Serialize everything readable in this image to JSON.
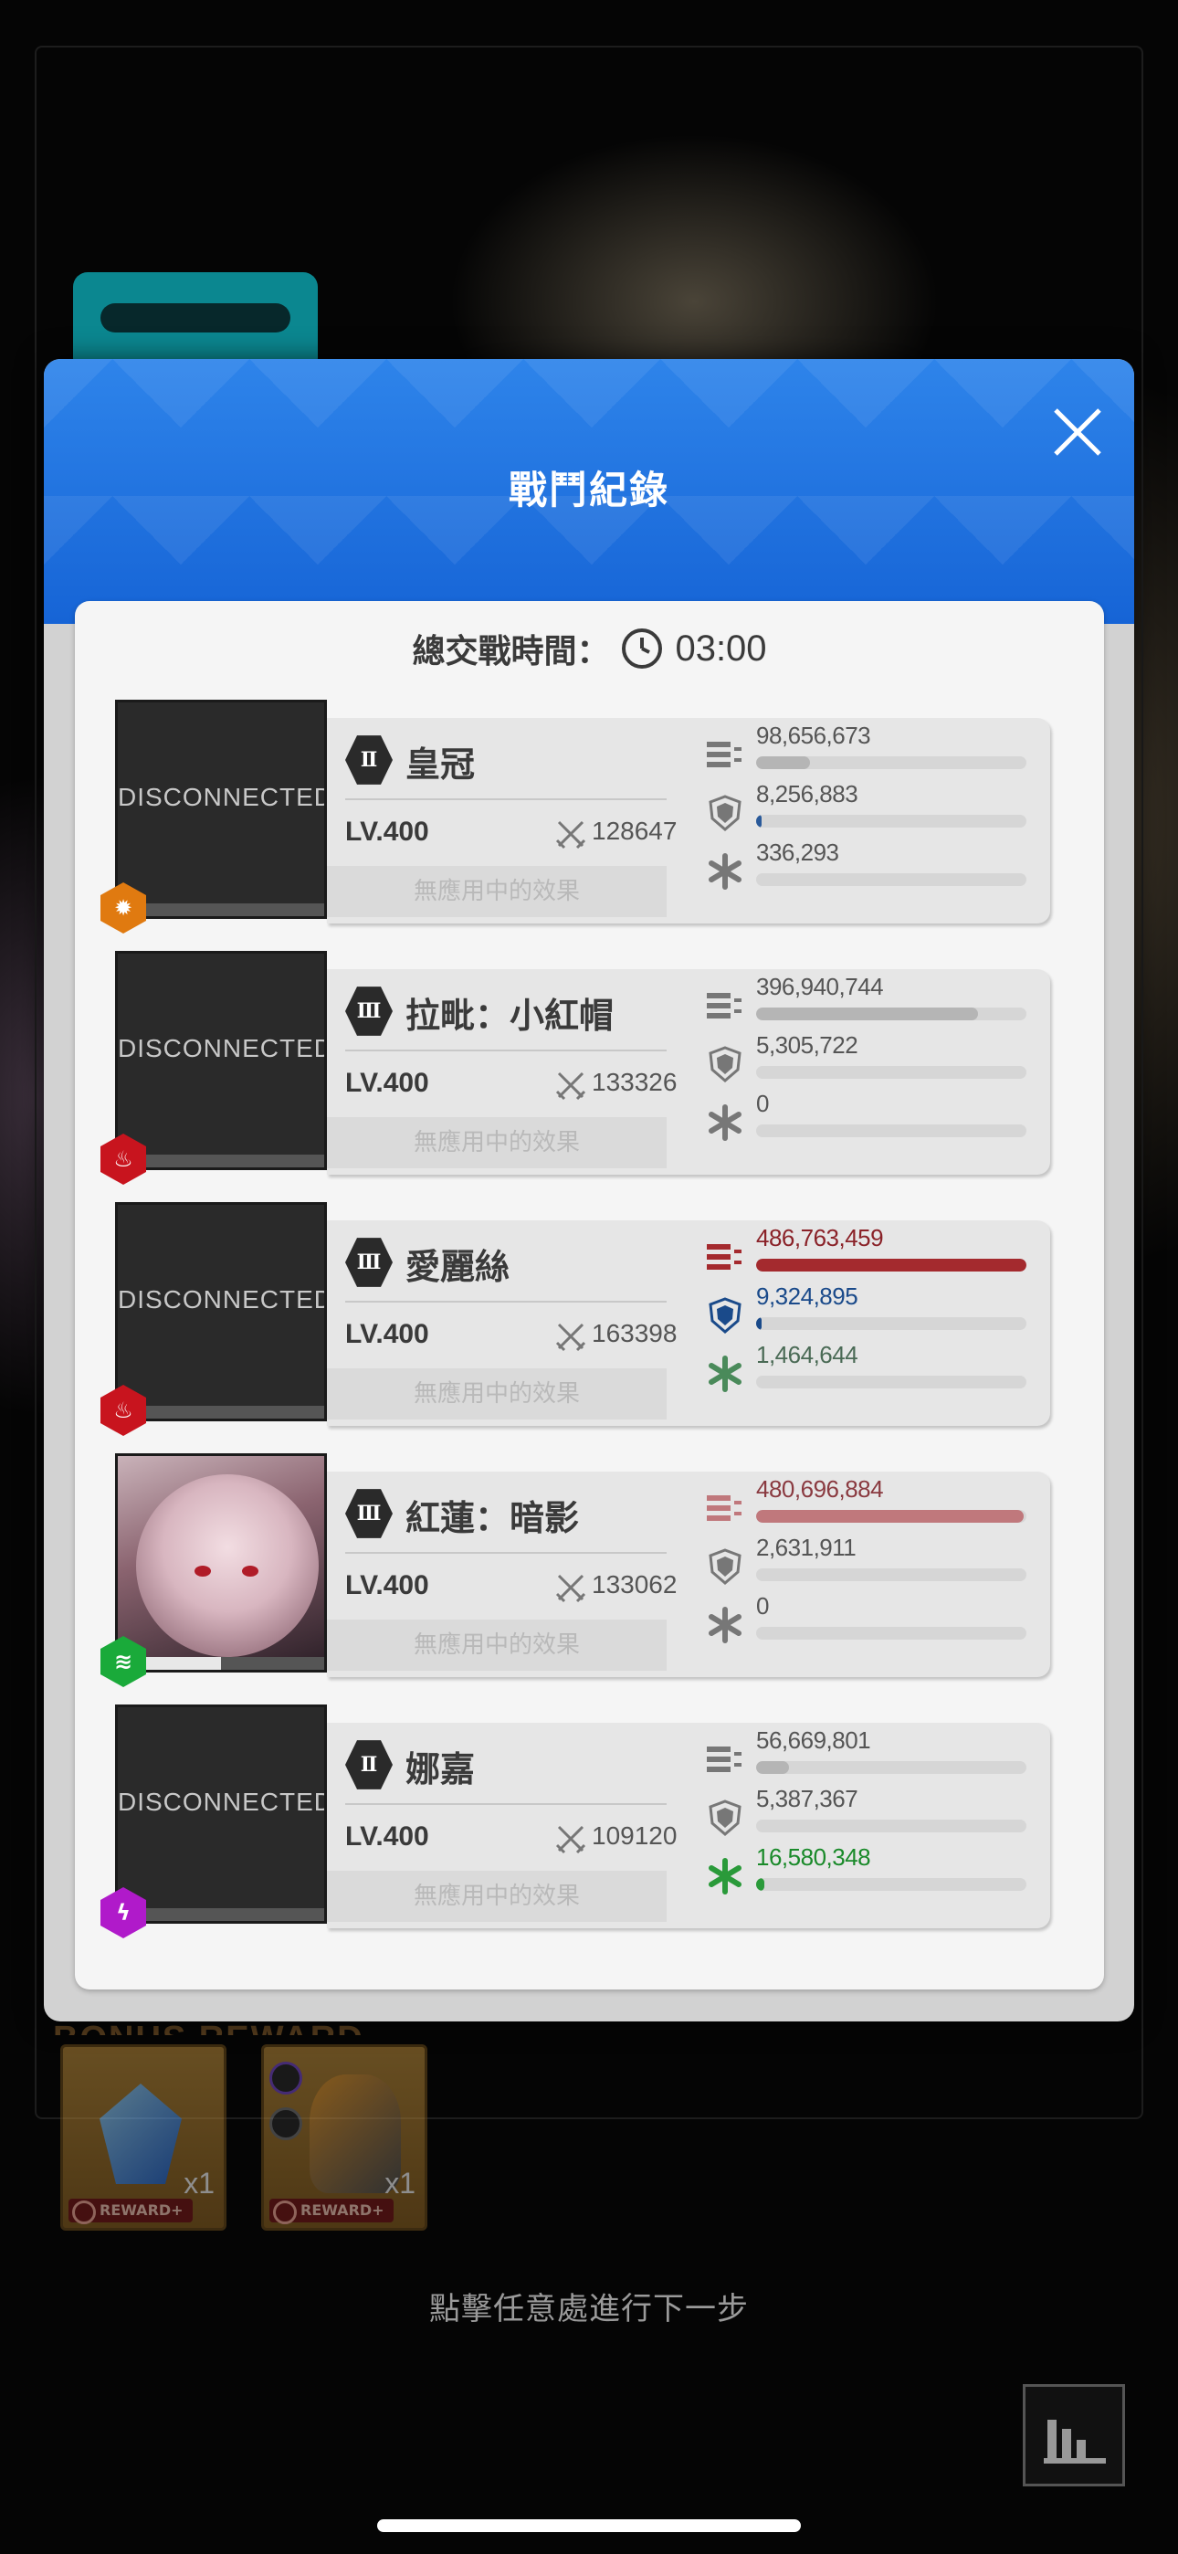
{
  "modal": {
    "title": "戰鬥紀錄",
    "time_label": "總交戰時間：",
    "time_value": "03:00"
  },
  "rows": [
    {
      "rank": "Ⅱ",
      "name": "皇冠",
      "level": "LV.400",
      "power": "128647",
      "effects": "無應用中的效果",
      "disconnected": "DISCONNECTED",
      "element_icon": "burst-hex-icon",
      "element_color": "#e07a10",
      "hp_fraction": 0.0,
      "damage": {
        "value": "98,656,673",
        "fraction": 0.2,
        "color": "#b5b5b5",
        "text_color": "#555555"
      },
      "shield": {
        "value": "8,256,883",
        "fraction": 0.02,
        "color": "#2a5a9a",
        "text_color": "#555555"
      },
      "heal": {
        "value": "336,293",
        "fraction": 0.0,
        "color": "#4a8a5a",
        "text_color": "#555555"
      }
    },
    {
      "rank": "Ⅲ",
      "name": "拉毗：小紅帽",
      "level": "LV.400",
      "power": "133326",
      "effects": "無應用中的效果",
      "disconnected": "DISCONNECTED",
      "element_icon": "fire-icon",
      "element_color": "#c8141e",
      "hp_fraction": 0.0,
      "damage": {
        "value": "396,940,744",
        "fraction": 0.82,
        "color": "#b5b5b5",
        "text_color": "#555555"
      },
      "shield": {
        "value": "5,305,722",
        "fraction": 0.0,
        "color": "#2a5a9a",
        "text_color": "#555555"
      },
      "heal": {
        "value": "0",
        "fraction": 0.0,
        "color": "#4a8a5a",
        "text_color": "#555555"
      }
    },
    {
      "rank": "Ⅲ",
      "name": "愛麗絲",
      "level": "LV.400",
      "power": "163398",
      "effects": "無應用中的效果",
      "disconnected": "DISCONNECTED",
      "element_icon": "fire-icon",
      "element_color": "#c8141e",
      "hp_fraction": 0.0,
      "damage": {
        "value": "486,763,459",
        "fraction": 1.0,
        "color": "#a42a2e",
        "text_color": "#8a2228"
      },
      "shield": {
        "value": "9,324,895",
        "fraction": 0.02,
        "color": "#1a4a8a",
        "text_color": "#1a4a8a"
      },
      "heal": {
        "value": "1,464,644",
        "fraction": 0.0,
        "color": "#4a8a5a",
        "text_color": "#4a6a55"
      }
    },
    {
      "rank": "Ⅲ",
      "name": "紅蓮：暗影",
      "level": "LV.400",
      "power": "133062",
      "effects": "無應用中的效果",
      "disconnected": "",
      "element_icon": "wind-icon",
      "element_color": "#1aaa3a",
      "hp_fraction": 0.5,
      "damage": {
        "value": "480,696,884",
        "fraction": 0.99,
        "color": "#c0787c",
        "text_color": "#8a3a40"
      },
      "shield": {
        "value": "2,631,911",
        "fraction": 0.0,
        "color": "#2a5a9a",
        "text_color": "#555555"
      },
      "heal": {
        "value": "0",
        "fraction": 0.0,
        "color": "#4a8a5a",
        "text_color": "#555555"
      }
    },
    {
      "rank": "Ⅱ",
      "name": "娜嘉",
      "level": "LV.400",
      "power": "109120",
      "effects": "無應用中的效果",
      "disconnected": "DISCONNECTED",
      "element_icon": "electric-icon",
      "element_color": "#b01aca",
      "hp_fraction": 0.0,
      "damage": {
        "value": "56,669,801",
        "fraction": 0.12,
        "color": "#b5b5b5",
        "text_color": "#555555"
      },
      "shield": {
        "value": "5,387,367",
        "fraction": 0.0,
        "color": "#2a5a9a",
        "text_color": "#555555"
      },
      "heal": {
        "value": "16,580,348",
        "fraction": 0.03,
        "color": "#2a9a3a",
        "text_color": "#1a8a2a"
      }
    }
  ],
  "rewards": [
    {
      "quantity": "x1",
      "tag": "REWARD+",
      "icon": "crystal-icon"
    },
    {
      "quantity": "x1",
      "tag": "REWARD+",
      "icon": "mech-icon"
    }
  ],
  "bonus_title": "BONUS REWARD",
  "next_hint": "點擊任意處進行下一步"
}
